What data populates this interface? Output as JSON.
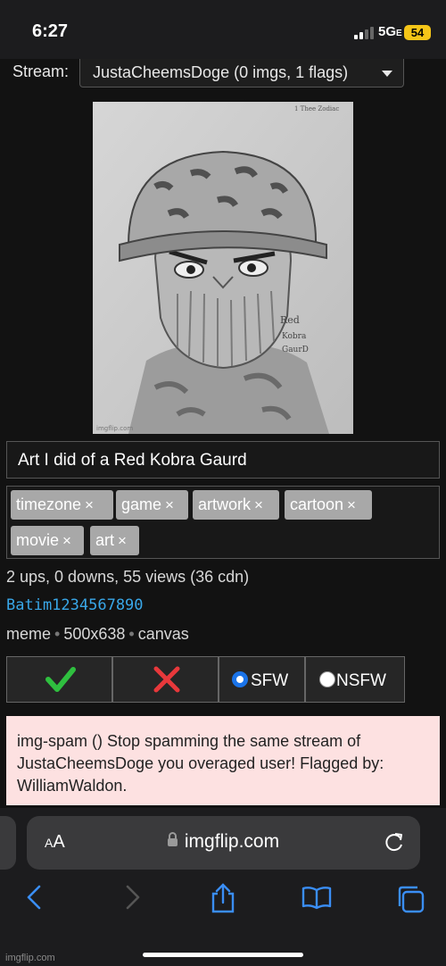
{
  "status": {
    "time": "6:27",
    "network": "5G",
    "network_sub": "E",
    "battery": "54"
  },
  "stream": {
    "label": "Stream:",
    "selected": "JustaCheemsDoge (0 imgs, 1 flags)"
  },
  "meme": {
    "title": "Art I did of a Red Kobra Gaurd",
    "tags": [
      "timezone",
      "game",
      "artwork",
      "cartoon",
      "movie",
      "art"
    ],
    "tag_remove_glyph": "×",
    "drawing_text": [
      "Red",
      "Kobra",
      "GaurD"
    ],
    "corner_signature": "1 Thee Zodiac",
    "image_watermark": "imgflip.com"
  },
  "stats": "2 ups, 0 downs, 55 views (36 cdn)",
  "author": "Batim1234567890",
  "meta": {
    "type": "meme",
    "size": "500x638",
    "source": "canvas",
    "separator": "•"
  },
  "moderation": {
    "sfw_label": "SFW",
    "nsfw_label": "NSFW",
    "selected": "SFW",
    "approve_color": "#2fbf3f",
    "reject_color": "#e8383b"
  },
  "flag_notice": "img-spam () Stop spamming the same stream of JustaCheemsDoge you overaged user! Flagged by: WilliamWaldon.",
  "browser": {
    "aa_small": "A",
    "aa_large": "A",
    "url": "imgflip.com"
  },
  "watermark": "imgflip.com"
}
